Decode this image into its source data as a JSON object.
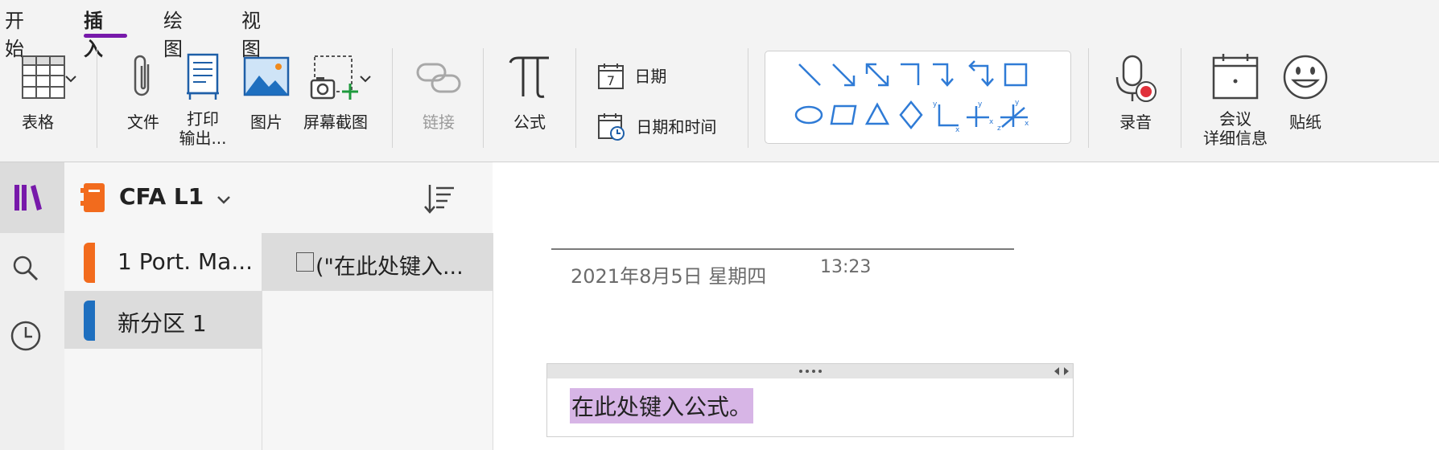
{
  "ribbon": {
    "tabs": [
      {
        "label": "开始"
      },
      {
        "label": "插入",
        "active": true
      },
      {
        "label": "绘图"
      },
      {
        "label": "视图"
      }
    ],
    "tools": {
      "table": "表格",
      "file": "文件",
      "print_line1": "打印",
      "print_line2": "输出...",
      "picture": "图片",
      "screenshot": "屏幕截图",
      "link": "链接",
      "equation": "公式",
      "date": "日期",
      "datetime": "日期和时间",
      "record": "录音",
      "meeting_line1": "会议",
      "meeting_line2": "详细信息",
      "sticker": "贴纸",
      "date_icon_number": "7"
    },
    "accent_color": "#7719aa",
    "shape_color": "#2f7bd6"
  },
  "notebook": {
    "name": "CFA L1",
    "sections": [
      {
        "label": "1 Port. Ma...",
        "color": "#f26b1d"
      },
      {
        "label": "新分区 1",
        "color": "#1e6fbf",
        "selected": true
      }
    ],
    "pages": [
      {
        "label": "(\"在此处键入...",
        "selected": true
      }
    ]
  },
  "note": {
    "date": "2021年8月5日 星期四",
    "time": "13:23",
    "equation_placeholder": "在此处键入公式。"
  }
}
